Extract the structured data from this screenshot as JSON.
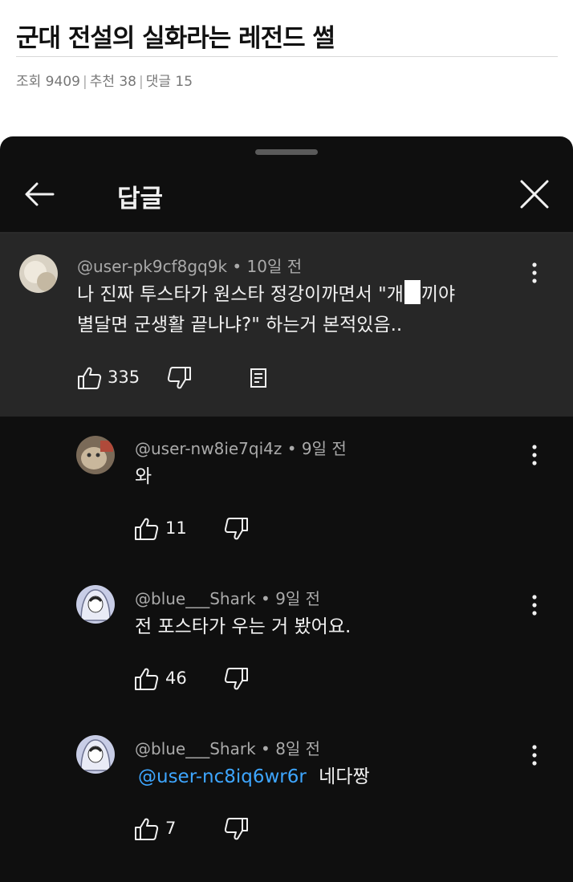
{
  "post": {
    "title": "군대 전설의 실화라는 레전드 썰",
    "views": "조회 9409",
    "likes": "추천 38",
    "comments": "댓글 15",
    "separator": "|"
  },
  "sheet": {
    "title": "답글",
    "back_icon": "arrow-left-icon",
    "close_icon": "close-icon"
  },
  "parent": {
    "handle": "@user-pk9cf8gq9k",
    "time": "10일 전",
    "line1_before": "나 진짜 투스타가 원스타 정강이까면서 \"개",
    "line1_after": "끼야",
    "line2": "별달면 군생활 끝나냐?\" 하는거 본적있음..",
    "likes": "335"
  },
  "replies": [
    {
      "handle": "@user-nw8ie7qi4z",
      "time": "9일 전",
      "text": "와",
      "likes": "11"
    },
    {
      "handle": "@blue___Shark",
      "time": "9일 전",
      "text": "전 포스타가 우는 거 봤어요.",
      "likes": "46"
    },
    {
      "handle": "@blue___Shark",
      "time": "8일 전",
      "mention": "@user-nc8iq6wr6r",
      "text": "네다짱",
      "likes": "7"
    }
  ],
  "dot": "•",
  "colors": {
    "sheet_bg": "#0f0f0f",
    "parent_bg": "#272727",
    "mention": "#3ea6ff",
    "secondary_text": "#aaaaaa"
  }
}
